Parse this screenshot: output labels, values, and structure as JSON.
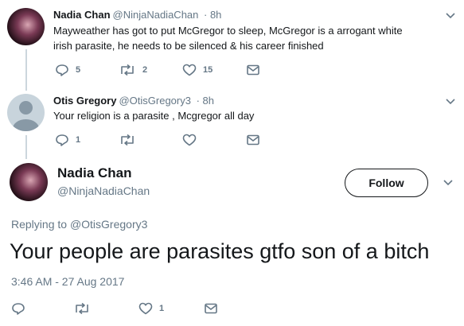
{
  "tweet1": {
    "name": "Nadia Chan",
    "handle": "@NinjaNadiaChan",
    "time": "· 8h",
    "text_line1": "Mayweather has got to put McGregor to sleep, McGregor is a arrogant white",
    "text_line2": "irish parasite, he needs to be silenced & his career finished",
    "replies": "5",
    "retweets": "2",
    "likes": "15"
  },
  "tweet2": {
    "name": "Otis Gregory",
    "handle": "@OtisGregory3",
    "time": "· 8h",
    "text": "Your religion is a parasite , Mcgregor all day",
    "replies": "1",
    "retweets": "",
    "likes": ""
  },
  "main_tweet": {
    "name": "Nadia Chan",
    "handle": "@NinjaNadiaChan",
    "follow_label": "Follow",
    "replying_prefix": "Replying to",
    "replying_to": "@OtisGregory3",
    "text": "Your people are parasites gtfo son of a bitch",
    "timestamp": "3:46 AM - 27 Aug 2017",
    "replies": "",
    "retweets": "",
    "likes": "1"
  },
  "icons": [
    "reply-icon",
    "retweet-icon",
    "like-icon",
    "dm-icon",
    "chevron-down-icon"
  ],
  "colors": {
    "text": "#14171a",
    "muted": "#657786",
    "line": "#ccd6dd"
  }
}
